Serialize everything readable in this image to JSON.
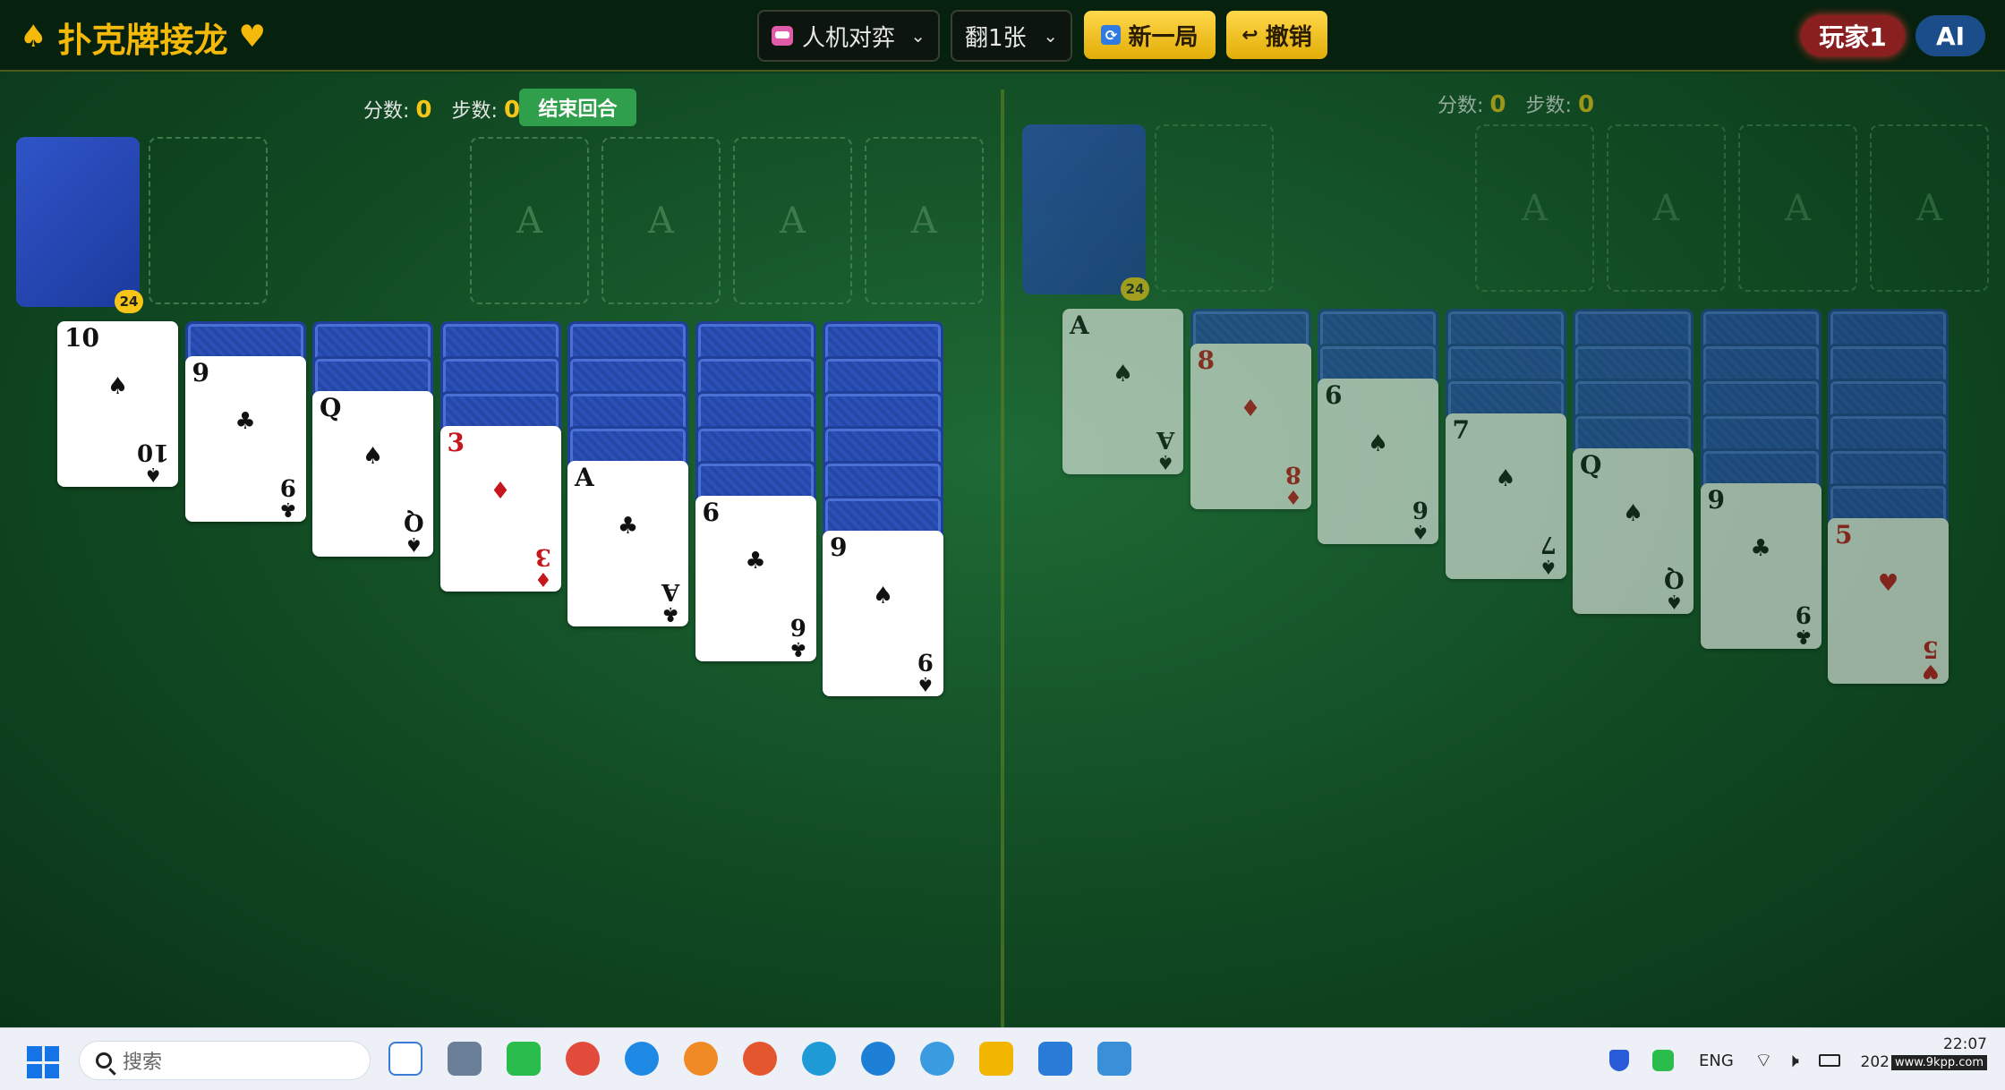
{
  "header": {
    "title": "扑克牌接龙",
    "title_left_suit": "♠",
    "title_right_suit": "♥",
    "mode_select": "人机对弈",
    "draw_select": "翻1张",
    "new_game": "新一局",
    "undo": "撤销",
    "player1": "玩家1",
    "ai": "AI"
  },
  "left": {
    "score_label": "分数:",
    "score": "0",
    "steps_label": "步数:",
    "steps": "0",
    "end_turn": "结束回合",
    "stock_count": "24",
    "foundation_placeholder": "A",
    "tableau": [
      {
        "hidden": 0,
        "rank": "10",
        "suit": "♠",
        "color": "black"
      },
      {
        "hidden": 1,
        "rank": "9",
        "suit": "♣",
        "color": "black"
      },
      {
        "hidden": 2,
        "rank": "Q",
        "suit": "♠",
        "color": "black"
      },
      {
        "hidden": 3,
        "rank": "3",
        "suit": "♦",
        "color": "red"
      },
      {
        "hidden": 4,
        "rank": "A",
        "suit": "♣",
        "color": "black"
      },
      {
        "hidden": 5,
        "rank": "6",
        "suit": "♣",
        "color": "black"
      },
      {
        "hidden": 6,
        "rank": "9",
        "suit": "♠",
        "color": "black"
      }
    ]
  },
  "right": {
    "score_label": "分数:",
    "score": "0",
    "steps_label": "步数:",
    "steps": "0",
    "stock_count": "24",
    "foundation_placeholder": "A",
    "tableau": [
      {
        "hidden": 0,
        "rank": "A",
        "suit": "♠",
        "color": "black"
      },
      {
        "hidden": 1,
        "rank": "8",
        "suit": "♦",
        "color": "red"
      },
      {
        "hidden": 2,
        "rank": "6",
        "suit": "♠",
        "color": "black"
      },
      {
        "hidden": 3,
        "rank": "7",
        "suit": "♠",
        "color": "black"
      },
      {
        "hidden": 4,
        "rank": "Q",
        "suit": "♠",
        "color": "black"
      },
      {
        "hidden": 5,
        "rank": "9",
        "suit": "♣",
        "color": "black"
      },
      {
        "hidden": 6,
        "rank": "5",
        "suit": "♥",
        "color": "red"
      }
    ]
  },
  "taskbar": {
    "search_placeholder": "搜索",
    "language": "ENG",
    "time": "22:07",
    "date": "202",
    "watermark": "www.9kpp.com",
    "apps": [
      "snipping-tool-icon",
      "calculator-icon",
      "wechat-icon",
      "chrome-icon",
      "browser-icon",
      "orange-app-icon",
      "firefox-icon",
      "edge-icon",
      "ie-icon",
      "cloud-icon",
      "file-explorer-icon",
      "vscode-icon",
      "notepad-icon"
    ]
  }
}
